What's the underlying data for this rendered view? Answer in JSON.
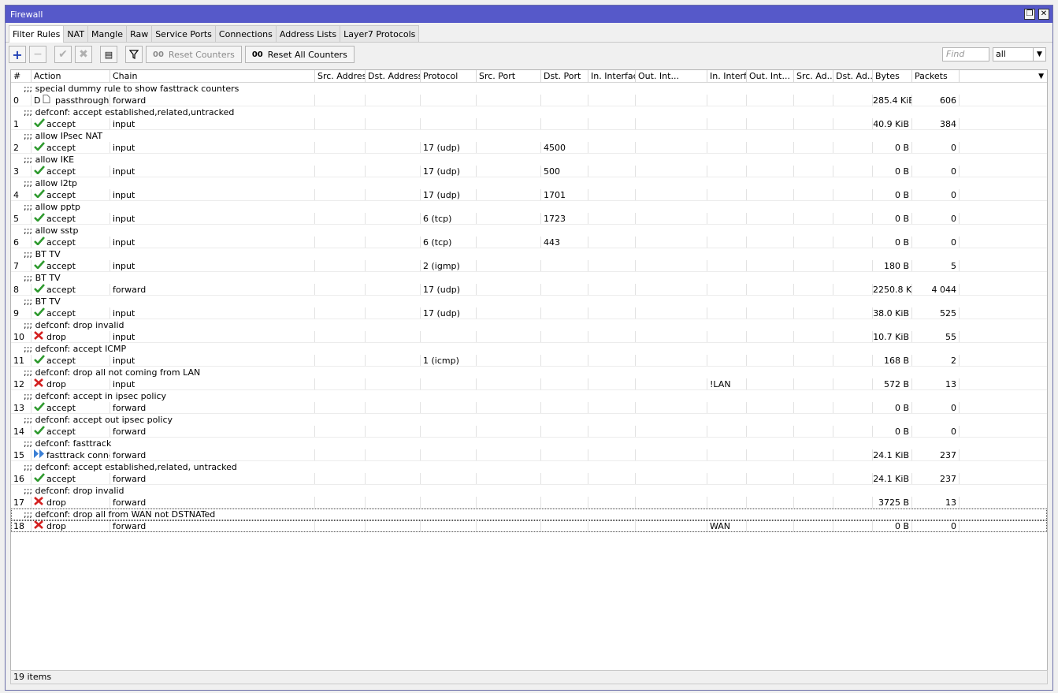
{
  "window": {
    "title": "Firewall",
    "restore_icon": "restore-icon",
    "close_icon": "close-icon"
  },
  "tabs": [
    "Filter Rules",
    "NAT",
    "Mangle",
    "Raw",
    "Service Ports",
    "Connections",
    "Address Lists",
    "Layer7 Protocols"
  ],
  "toolbar": {
    "add_icon": "plus-icon",
    "remove_icon": "minus-icon",
    "enable_icon": "check-icon",
    "disable_icon": "x-icon",
    "comment_icon": "comment-icon",
    "filter_icon": "filter-icon",
    "reset_counters_label": "Reset Counters",
    "reset_all_counters_label": "Reset All Counters",
    "counter_glyph": "00",
    "find_placeholder": "Find",
    "filter_value": "all"
  },
  "columns": [
    "#",
    "Action",
    "Chain",
    "Src. Address",
    "Dst. Address",
    "Protocol",
    "Src. Port",
    "Dst. Port",
    "In. Interface",
    "Out. Int...",
    "In. Interfa...",
    "Out. Int...",
    "Src. Ad...",
    "Dst. Ad...",
    "Bytes",
    "Packets"
  ],
  "rules": [
    {
      "comment": ";;; special dummy rule to show fasttrack counters",
      "num": "0",
      "flag": "D",
      "action": "passthrough",
      "icon": "passthrough-icon",
      "chain": "forward",
      "protocol": "",
      "dst_port": "",
      "in_iface_list": "",
      "bytes": "285.4 KiB",
      "packets": "606"
    },
    {
      "comment": ";;; defconf: accept established,related,untracked",
      "num": "1",
      "flag": "",
      "action": "accept",
      "icon": "accept-icon",
      "chain": "input",
      "protocol": "",
      "dst_port": "",
      "in_iface_list": "",
      "bytes": "40.9 KiB",
      "packets": "384"
    },
    {
      "comment": ";;; allow IPsec NAT",
      "num": "2",
      "flag": "",
      "action": "accept",
      "icon": "accept-icon",
      "chain": "input",
      "protocol": "17 (udp)",
      "dst_port": "4500",
      "in_iface_list": "",
      "bytes": "0 B",
      "packets": "0"
    },
    {
      "comment": ";;; allow IKE",
      "num": "3",
      "flag": "",
      "action": "accept",
      "icon": "accept-icon",
      "chain": "input",
      "protocol": "17 (udp)",
      "dst_port": "500",
      "in_iface_list": "",
      "bytes": "0 B",
      "packets": "0"
    },
    {
      "comment": ";;; allow l2tp",
      "num": "4",
      "flag": "",
      "action": "accept",
      "icon": "accept-icon",
      "chain": "input",
      "protocol": "17 (udp)",
      "dst_port": "1701",
      "in_iface_list": "",
      "bytes": "0 B",
      "packets": "0"
    },
    {
      "comment": ";;; allow pptp",
      "num": "5",
      "flag": "",
      "action": "accept",
      "icon": "accept-icon",
      "chain": "input",
      "protocol": "6 (tcp)",
      "dst_port": "1723",
      "in_iface_list": "",
      "bytes": "0 B",
      "packets": "0"
    },
    {
      "comment": ";;; allow sstp",
      "num": "6",
      "flag": "",
      "action": "accept",
      "icon": "accept-icon",
      "chain": "input",
      "protocol": "6 (tcp)",
      "dst_port": "443",
      "in_iface_list": "",
      "bytes": "0 B",
      "packets": "0"
    },
    {
      "comment": ";;; BT TV",
      "num": "7",
      "flag": "",
      "action": "accept",
      "icon": "accept-icon",
      "chain": "input",
      "protocol": "2 (igmp)",
      "dst_port": "",
      "in_iface_list": "",
      "bytes": "180 B",
      "packets": "5"
    },
    {
      "comment": ";;; BT TV",
      "num": "8",
      "flag": "",
      "action": "accept",
      "icon": "accept-icon",
      "chain": "forward",
      "protocol": "17 (udp)",
      "dst_port": "",
      "in_iface_list": "",
      "bytes": "2250.8 KiB",
      "packets": "4 044"
    },
    {
      "comment": ";;; BT TV",
      "num": "9",
      "flag": "",
      "action": "accept",
      "icon": "accept-icon",
      "chain": "input",
      "protocol": "17 (udp)",
      "dst_port": "",
      "in_iface_list": "",
      "bytes": "38.0 KiB",
      "packets": "525"
    },
    {
      "comment": ";;; defconf: drop invalid",
      "num": "10",
      "flag": "",
      "action": "drop",
      "icon": "drop-icon",
      "chain": "input",
      "protocol": "",
      "dst_port": "",
      "in_iface_list": "",
      "bytes": "10.7 KiB",
      "packets": "55"
    },
    {
      "comment": ";;; defconf: accept ICMP",
      "num": "11",
      "flag": "",
      "action": "accept",
      "icon": "accept-icon",
      "chain": "input",
      "protocol": "1 (icmp)",
      "dst_port": "",
      "in_iface_list": "",
      "bytes": "168 B",
      "packets": "2"
    },
    {
      "comment": ";;; defconf: drop all not coming from LAN",
      "num": "12",
      "flag": "",
      "action": "drop",
      "icon": "drop-icon",
      "chain": "input",
      "protocol": "",
      "dst_port": "",
      "in_iface_list": "!LAN",
      "bytes": "572 B",
      "packets": "13"
    },
    {
      "comment": ";;; defconf: accept in ipsec policy",
      "num": "13",
      "flag": "",
      "action": "accept",
      "icon": "accept-icon",
      "chain": "forward",
      "protocol": "",
      "dst_port": "",
      "in_iface_list": "",
      "bytes": "0 B",
      "packets": "0"
    },
    {
      "comment": ";;; defconf: accept out ipsec policy",
      "num": "14",
      "flag": "",
      "action": "accept",
      "icon": "accept-icon",
      "chain": "forward",
      "protocol": "",
      "dst_port": "",
      "in_iface_list": "",
      "bytes": "0 B",
      "packets": "0"
    },
    {
      "comment": ";;; defconf: fasttrack",
      "num": "15",
      "flag": "",
      "action": "fasttrack connection",
      "icon": "fasttrack-icon",
      "chain": "forward",
      "protocol": "",
      "dst_port": "",
      "in_iface_list": "",
      "bytes": "24.1 KiB",
      "packets": "237"
    },
    {
      "comment": ";;; defconf: accept established,related, untracked",
      "num": "16",
      "flag": "",
      "action": "accept",
      "icon": "accept-icon",
      "chain": "forward",
      "protocol": "",
      "dst_port": "",
      "in_iface_list": "",
      "bytes": "24.1 KiB",
      "packets": "237"
    },
    {
      "comment": ";;; defconf: drop invalid",
      "num": "17",
      "flag": "",
      "action": "drop",
      "icon": "drop-icon",
      "chain": "forward",
      "protocol": "",
      "dst_port": "",
      "in_iface_list": "",
      "bytes": "3725 B",
      "packets": "13"
    },
    {
      "comment": ";;; defconf:  drop all from WAN not DSTNATed",
      "num": "18",
      "flag": "",
      "action": "drop",
      "icon": "drop-icon",
      "chain": "forward",
      "protocol": "",
      "dst_port": "",
      "in_iface_list": "WAN",
      "bytes": "0 B",
      "packets": "0"
    }
  ],
  "status": {
    "item_count": "19 items"
  },
  "colors": {
    "titlebar": "#5659c9",
    "accept": "#2e9a2e",
    "drop": "#d42020",
    "fasttrack": "#3a7fd5",
    "add": "#1f3fb5"
  }
}
